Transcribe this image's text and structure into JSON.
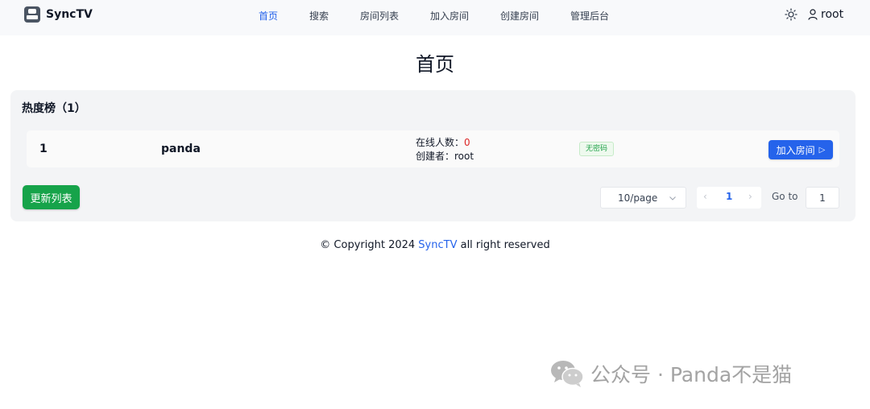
{
  "app": {
    "name": "SyncTV"
  },
  "nav": {
    "items": [
      {
        "label": "首页",
        "active": true
      },
      {
        "label": "搜索"
      },
      {
        "label": "房间列表"
      },
      {
        "label": "加入房间"
      },
      {
        "label": "创建房间"
      },
      {
        "label": "管理后台"
      }
    ],
    "user": "root",
    "theme_icon": "sun-icon",
    "user_icon": "user-icon"
  },
  "page": {
    "title": "首页"
  },
  "hot_list": {
    "title": "热度榜（1）",
    "rooms": [
      {
        "rank": "1",
        "name": "panda",
        "online_label": "在线人数：",
        "online_count": "0",
        "creator_label": "创建者：",
        "creator": "root",
        "badge": "无密码",
        "join_label": "加入房间"
      }
    ],
    "refresh_label": "更新列表",
    "pagination": {
      "page_size": "10/page",
      "current_page": "1",
      "goto_label": "Go to",
      "goto_value": "1"
    }
  },
  "footer": {
    "prefix": "© Copyright 2024 ",
    "brand": "SyncTV",
    "suffix": " all right reserved"
  },
  "watermark": {
    "text": "公众号 · Panda不是猫"
  },
  "colors": {
    "accent": "#2563eb",
    "success": "#16a34a",
    "danger": "#dc2626",
    "card_bg": "#f3f4f6"
  }
}
